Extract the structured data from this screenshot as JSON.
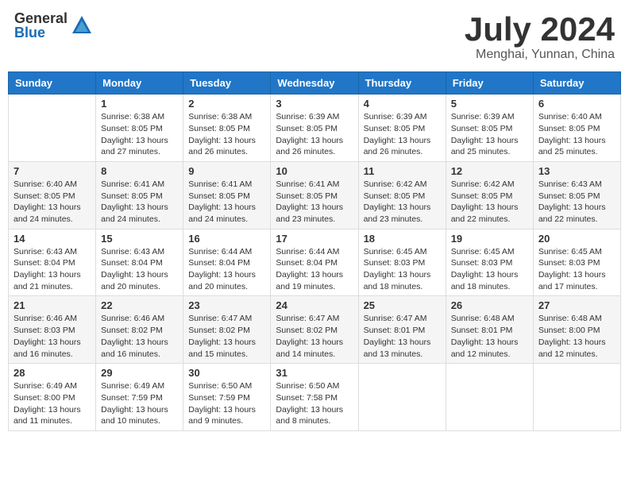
{
  "header": {
    "logo_general": "General",
    "logo_blue": "Blue",
    "month_year": "July 2024",
    "location": "Menghai, Yunnan, China"
  },
  "weekdays": [
    "Sunday",
    "Monday",
    "Tuesday",
    "Wednesday",
    "Thursday",
    "Friday",
    "Saturday"
  ],
  "weeks": [
    [
      {
        "day": "",
        "sunrise": "",
        "sunset": "",
        "daylight": ""
      },
      {
        "day": "1",
        "sunrise": "Sunrise: 6:38 AM",
        "sunset": "Sunset: 8:05 PM",
        "daylight": "Daylight: 13 hours and 27 minutes."
      },
      {
        "day": "2",
        "sunrise": "Sunrise: 6:38 AM",
        "sunset": "Sunset: 8:05 PM",
        "daylight": "Daylight: 13 hours and 26 minutes."
      },
      {
        "day": "3",
        "sunrise": "Sunrise: 6:39 AM",
        "sunset": "Sunset: 8:05 PM",
        "daylight": "Daylight: 13 hours and 26 minutes."
      },
      {
        "day": "4",
        "sunrise": "Sunrise: 6:39 AM",
        "sunset": "Sunset: 8:05 PM",
        "daylight": "Daylight: 13 hours and 26 minutes."
      },
      {
        "day": "5",
        "sunrise": "Sunrise: 6:39 AM",
        "sunset": "Sunset: 8:05 PM",
        "daylight": "Daylight: 13 hours and 25 minutes."
      },
      {
        "day": "6",
        "sunrise": "Sunrise: 6:40 AM",
        "sunset": "Sunset: 8:05 PM",
        "daylight": "Daylight: 13 hours and 25 minutes."
      }
    ],
    [
      {
        "day": "7",
        "sunrise": "Sunrise: 6:40 AM",
        "sunset": "Sunset: 8:05 PM",
        "daylight": "Daylight: 13 hours and 24 minutes."
      },
      {
        "day": "8",
        "sunrise": "Sunrise: 6:41 AM",
        "sunset": "Sunset: 8:05 PM",
        "daylight": "Daylight: 13 hours and 24 minutes."
      },
      {
        "day": "9",
        "sunrise": "Sunrise: 6:41 AM",
        "sunset": "Sunset: 8:05 PM",
        "daylight": "Daylight: 13 hours and 24 minutes."
      },
      {
        "day": "10",
        "sunrise": "Sunrise: 6:41 AM",
        "sunset": "Sunset: 8:05 PM",
        "daylight": "Daylight: 13 hours and 23 minutes."
      },
      {
        "day": "11",
        "sunrise": "Sunrise: 6:42 AM",
        "sunset": "Sunset: 8:05 PM",
        "daylight": "Daylight: 13 hours and 23 minutes."
      },
      {
        "day": "12",
        "sunrise": "Sunrise: 6:42 AM",
        "sunset": "Sunset: 8:05 PM",
        "daylight": "Daylight: 13 hours and 22 minutes."
      },
      {
        "day": "13",
        "sunrise": "Sunrise: 6:43 AM",
        "sunset": "Sunset: 8:05 PM",
        "daylight": "Daylight: 13 hours and 22 minutes."
      }
    ],
    [
      {
        "day": "14",
        "sunrise": "Sunrise: 6:43 AM",
        "sunset": "Sunset: 8:04 PM",
        "daylight": "Daylight: 13 hours and 21 minutes."
      },
      {
        "day": "15",
        "sunrise": "Sunrise: 6:43 AM",
        "sunset": "Sunset: 8:04 PM",
        "daylight": "Daylight: 13 hours and 20 minutes."
      },
      {
        "day": "16",
        "sunrise": "Sunrise: 6:44 AM",
        "sunset": "Sunset: 8:04 PM",
        "daylight": "Daylight: 13 hours and 20 minutes."
      },
      {
        "day": "17",
        "sunrise": "Sunrise: 6:44 AM",
        "sunset": "Sunset: 8:04 PM",
        "daylight": "Daylight: 13 hours and 19 minutes."
      },
      {
        "day": "18",
        "sunrise": "Sunrise: 6:45 AM",
        "sunset": "Sunset: 8:03 PM",
        "daylight": "Daylight: 13 hours and 18 minutes."
      },
      {
        "day": "19",
        "sunrise": "Sunrise: 6:45 AM",
        "sunset": "Sunset: 8:03 PM",
        "daylight": "Daylight: 13 hours and 18 minutes."
      },
      {
        "day": "20",
        "sunrise": "Sunrise: 6:45 AM",
        "sunset": "Sunset: 8:03 PM",
        "daylight": "Daylight: 13 hours and 17 minutes."
      }
    ],
    [
      {
        "day": "21",
        "sunrise": "Sunrise: 6:46 AM",
        "sunset": "Sunset: 8:03 PM",
        "daylight": "Daylight: 13 hours and 16 minutes."
      },
      {
        "day": "22",
        "sunrise": "Sunrise: 6:46 AM",
        "sunset": "Sunset: 8:02 PM",
        "daylight": "Daylight: 13 hours and 16 minutes."
      },
      {
        "day": "23",
        "sunrise": "Sunrise: 6:47 AM",
        "sunset": "Sunset: 8:02 PM",
        "daylight": "Daylight: 13 hours and 15 minutes."
      },
      {
        "day": "24",
        "sunrise": "Sunrise: 6:47 AM",
        "sunset": "Sunset: 8:02 PM",
        "daylight": "Daylight: 13 hours and 14 minutes."
      },
      {
        "day": "25",
        "sunrise": "Sunrise: 6:47 AM",
        "sunset": "Sunset: 8:01 PM",
        "daylight": "Daylight: 13 hours and 13 minutes."
      },
      {
        "day": "26",
        "sunrise": "Sunrise: 6:48 AM",
        "sunset": "Sunset: 8:01 PM",
        "daylight": "Daylight: 13 hours and 12 minutes."
      },
      {
        "day": "27",
        "sunrise": "Sunrise: 6:48 AM",
        "sunset": "Sunset: 8:00 PM",
        "daylight": "Daylight: 13 hours and 12 minutes."
      }
    ],
    [
      {
        "day": "28",
        "sunrise": "Sunrise: 6:49 AM",
        "sunset": "Sunset: 8:00 PM",
        "daylight": "Daylight: 13 hours and 11 minutes."
      },
      {
        "day": "29",
        "sunrise": "Sunrise: 6:49 AM",
        "sunset": "Sunset: 7:59 PM",
        "daylight": "Daylight: 13 hours and 10 minutes."
      },
      {
        "day": "30",
        "sunrise": "Sunrise: 6:50 AM",
        "sunset": "Sunset: 7:59 PM",
        "daylight": "Daylight: 13 hours and 9 minutes."
      },
      {
        "day": "31",
        "sunrise": "Sunrise: 6:50 AM",
        "sunset": "Sunset: 7:58 PM",
        "daylight": "Daylight: 13 hours and 8 minutes."
      },
      {
        "day": "",
        "sunrise": "",
        "sunset": "",
        "daylight": ""
      },
      {
        "day": "",
        "sunrise": "",
        "sunset": "",
        "daylight": ""
      },
      {
        "day": "",
        "sunrise": "",
        "sunset": "",
        "daylight": ""
      }
    ]
  ]
}
